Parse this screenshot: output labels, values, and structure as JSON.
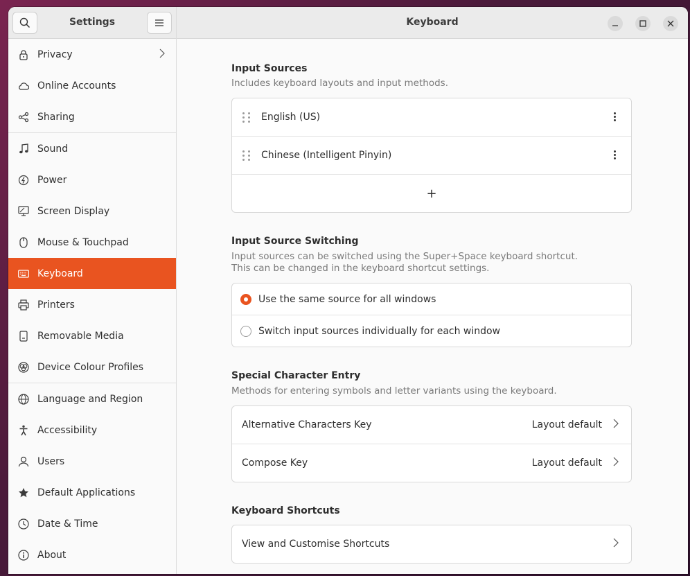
{
  "sidebar": {
    "title": "Settings",
    "search_icon": "search-icon",
    "menu_icon": "hamburger-menu-icon",
    "items": [
      {
        "label": "Privacy",
        "icon": "lock-icon",
        "has_chevron": true
      },
      {
        "label": "Online Accounts",
        "icon": "cloud-icon"
      },
      {
        "label": "Sharing",
        "icon": "share-icon"
      },
      {
        "label": "Sound",
        "icon": "music-note-icon"
      },
      {
        "label": "Power",
        "icon": "power-icon"
      },
      {
        "label": "Screen Display",
        "icon": "display-icon"
      },
      {
        "label": "Mouse & Touchpad",
        "icon": "mouse-icon"
      },
      {
        "label": "Keyboard",
        "icon": "keyboard-icon",
        "selected": true
      },
      {
        "label": "Printers",
        "icon": "printer-icon"
      },
      {
        "label": "Removable Media",
        "icon": "removable-media-icon"
      },
      {
        "label": "Device Colour Profiles",
        "icon": "colour-profile-icon"
      },
      {
        "label": "Language and Region",
        "icon": "globe-icon"
      },
      {
        "label": "Accessibility",
        "icon": "accessibility-icon"
      },
      {
        "label": "Users",
        "icon": "user-icon"
      },
      {
        "label": "Default Applications",
        "icon": "star-icon"
      },
      {
        "label": "Date & Time",
        "icon": "clock-icon"
      },
      {
        "label": "About",
        "icon": "info-icon"
      }
    ]
  },
  "header": {
    "title": "Keyboard"
  },
  "input_sources": {
    "title": "Input Sources",
    "subtitle": "Includes keyboard layouts and input methods.",
    "items": [
      "English (US)",
      "Chinese (Intelligent Pinyin)"
    ],
    "add_label": "+"
  },
  "switching": {
    "title": "Input Source Switching",
    "subtitle_line1": "Input sources can be switched using the Super+Space keyboard shortcut.",
    "subtitle_line2": "This can be changed in the keyboard shortcut settings.",
    "options": [
      {
        "label": "Use the same source for all windows",
        "checked": true
      },
      {
        "label": "Switch input sources individually for each window",
        "checked": false
      }
    ]
  },
  "special": {
    "title": "Special Character Entry",
    "subtitle": "Methods for entering symbols and letter variants using the keyboard.",
    "rows": [
      {
        "label": "Alternative Characters Key",
        "value": "Layout default"
      },
      {
        "label": "Compose Key",
        "value": "Layout default"
      }
    ]
  },
  "shortcuts": {
    "title": "Keyboard Shortcuts",
    "row_label": "View and Customise Shortcuts"
  },
  "colors": {
    "accent": "#e95420"
  }
}
